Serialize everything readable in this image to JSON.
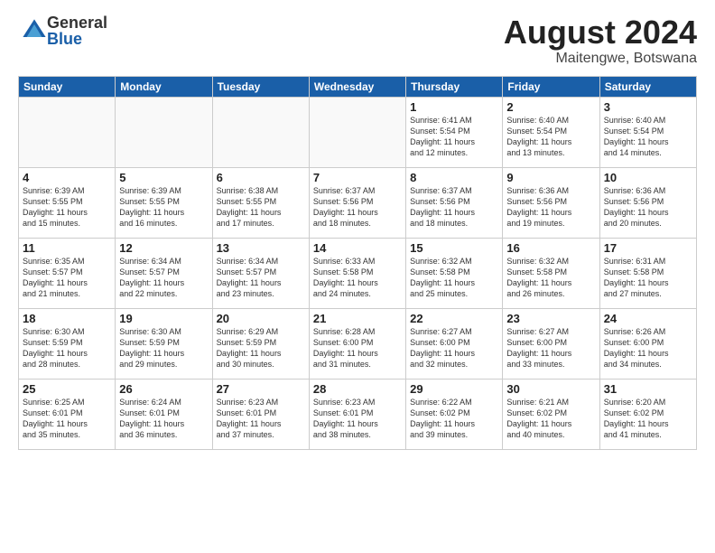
{
  "header": {
    "logo_general": "General",
    "logo_blue": "Blue",
    "month_title": "August 2024",
    "location": "Maitengwe, Botswana"
  },
  "days_of_week": [
    "Sunday",
    "Monday",
    "Tuesday",
    "Wednesday",
    "Thursday",
    "Friday",
    "Saturday"
  ],
  "weeks": [
    [
      {
        "day": "",
        "info": ""
      },
      {
        "day": "",
        "info": ""
      },
      {
        "day": "",
        "info": ""
      },
      {
        "day": "",
        "info": ""
      },
      {
        "day": "1",
        "info": "Sunrise: 6:41 AM\nSunset: 5:54 PM\nDaylight: 11 hours\nand 12 minutes."
      },
      {
        "day": "2",
        "info": "Sunrise: 6:40 AM\nSunset: 5:54 PM\nDaylight: 11 hours\nand 13 minutes."
      },
      {
        "day": "3",
        "info": "Sunrise: 6:40 AM\nSunset: 5:54 PM\nDaylight: 11 hours\nand 14 minutes."
      }
    ],
    [
      {
        "day": "4",
        "info": "Sunrise: 6:39 AM\nSunset: 5:55 PM\nDaylight: 11 hours\nand 15 minutes."
      },
      {
        "day": "5",
        "info": "Sunrise: 6:39 AM\nSunset: 5:55 PM\nDaylight: 11 hours\nand 16 minutes."
      },
      {
        "day": "6",
        "info": "Sunrise: 6:38 AM\nSunset: 5:55 PM\nDaylight: 11 hours\nand 17 minutes."
      },
      {
        "day": "7",
        "info": "Sunrise: 6:37 AM\nSunset: 5:56 PM\nDaylight: 11 hours\nand 18 minutes."
      },
      {
        "day": "8",
        "info": "Sunrise: 6:37 AM\nSunset: 5:56 PM\nDaylight: 11 hours\nand 18 minutes."
      },
      {
        "day": "9",
        "info": "Sunrise: 6:36 AM\nSunset: 5:56 PM\nDaylight: 11 hours\nand 19 minutes."
      },
      {
        "day": "10",
        "info": "Sunrise: 6:36 AM\nSunset: 5:56 PM\nDaylight: 11 hours\nand 20 minutes."
      }
    ],
    [
      {
        "day": "11",
        "info": "Sunrise: 6:35 AM\nSunset: 5:57 PM\nDaylight: 11 hours\nand 21 minutes."
      },
      {
        "day": "12",
        "info": "Sunrise: 6:34 AM\nSunset: 5:57 PM\nDaylight: 11 hours\nand 22 minutes."
      },
      {
        "day": "13",
        "info": "Sunrise: 6:34 AM\nSunset: 5:57 PM\nDaylight: 11 hours\nand 23 minutes."
      },
      {
        "day": "14",
        "info": "Sunrise: 6:33 AM\nSunset: 5:58 PM\nDaylight: 11 hours\nand 24 minutes."
      },
      {
        "day": "15",
        "info": "Sunrise: 6:32 AM\nSunset: 5:58 PM\nDaylight: 11 hours\nand 25 minutes."
      },
      {
        "day": "16",
        "info": "Sunrise: 6:32 AM\nSunset: 5:58 PM\nDaylight: 11 hours\nand 26 minutes."
      },
      {
        "day": "17",
        "info": "Sunrise: 6:31 AM\nSunset: 5:58 PM\nDaylight: 11 hours\nand 27 minutes."
      }
    ],
    [
      {
        "day": "18",
        "info": "Sunrise: 6:30 AM\nSunset: 5:59 PM\nDaylight: 11 hours\nand 28 minutes."
      },
      {
        "day": "19",
        "info": "Sunrise: 6:30 AM\nSunset: 5:59 PM\nDaylight: 11 hours\nand 29 minutes."
      },
      {
        "day": "20",
        "info": "Sunrise: 6:29 AM\nSunset: 5:59 PM\nDaylight: 11 hours\nand 30 minutes."
      },
      {
        "day": "21",
        "info": "Sunrise: 6:28 AM\nSunset: 6:00 PM\nDaylight: 11 hours\nand 31 minutes."
      },
      {
        "day": "22",
        "info": "Sunrise: 6:27 AM\nSunset: 6:00 PM\nDaylight: 11 hours\nand 32 minutes."
      },
      {
        "day": "23",
        "info": "Sunrise: 6:27 AM\nSunset: 6:00 PM\nDaylight: 11 hours\nand 33 minutes."
      },
      {
        "day": "24",
        "info": "Sunrise: 6:26 AM\nSunset: 6:00 PM\nDaylight: 11 hours\nand 34 minutes."
      }
    ],
    [
      {
        "day": "25",
        "info": "Sunrise: 6:25 AM\nSunset: 6:01 PM\nDaylight: 11 hours\nand 35 minutes."
      },
      {
        "day": "26",
        "info": "Sunrise: 6:24 AM\nSunset: 6:01 PM\nDaylight: 11 hours\nand 36 minutes."
      },
      {
        "day": "27",
        "info": "Sunrise: 6:23 AM\nSunset: 6:01 PM\nDaylight: 11 hours\nand 37 minutes."
      },
      {
        "day": "28",
        "info": "Sunrise: 6:23 AM\nSunset: 6:01 PM\nDaylight: 11 hours\nand 38 minutes."
      },
      {
        "day": "29",
        "info": "Sunrise: 6:22 AM\nSunset: 6:02 PM\nDaylight: 11 hours\nand 39 minutes."
      },
      {
        "day": "30",
        "info": "Sunrise: 6:21 AM\nSunset: 6:02 PM\nDaylight: 11 hours\nand 40 minutes."
      },
      {
        "day": "31",
        "info": "Sunrise: 6:20 AM\nSunset: 6:02 PM\nDaylight: 11 hours\nand 41 minutes."
      }
    ]
  ]
}
